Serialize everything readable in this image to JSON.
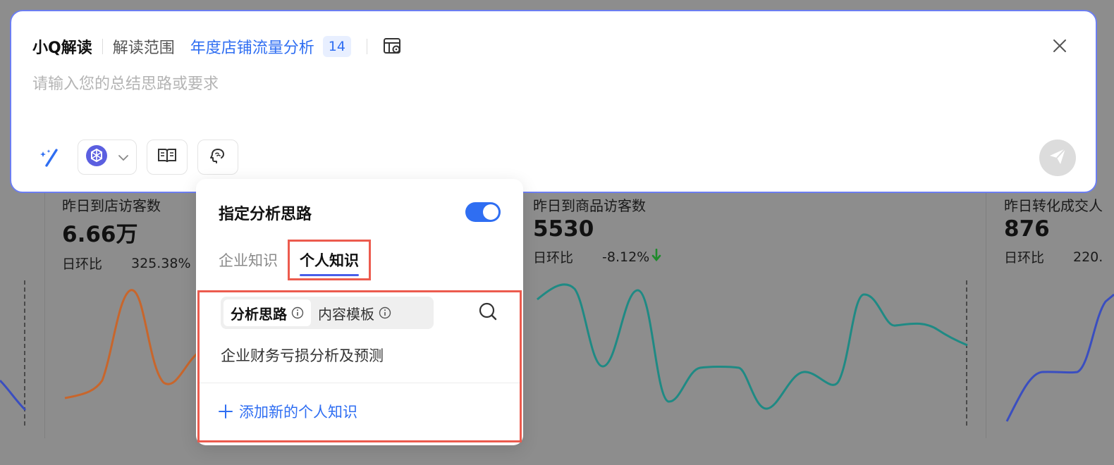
{
  "header": {
    "brand": "小Q解读",
    "scope_label": "解读范围",
    "scope_link": "年度店铺流量分析",
    "scope_count": "14"
  },
  "input": {
    "placeholder": "请输入您的总结思路或要求",
    "value": ""
  },
  "toolbar": {
    "icons": [
      "magic-wand-icon",
      "model-logo-icon",
      "chevron-down-icon",
      "book-icon",
      "brain-chat-icon",
      "send-icon",
      "table-settings-icon",
      "close-icon"
    ]
  },
  "popover": {
    "title": "指定分析思路",
    "toggle_on": true,
    "tabs": [
      {
        "label": "企业知识",
        "active": false
      },
      {
        "label": "个人知识",
        "active": true
      }
    ],
    "segments": [
      {
        "label": "分析思路",
        "active": true
      },
      {
        "label": "内容模板",
        "active": false
      }
    ],
    "entries": [
      {
        "label": "企业财务亏损分析及预测"
      }
    ],
    "add_label": "添加新的个人知识"
  },
  "metrics": [
    {
      "label": "昨日到店访客数",
      "value": "6.66万",
      "change_label": "日环比",
      "change": "325.38%",
      "direction": "up"
    },
    {
      "label": "昨日到商品访客数",
      "value": "5530",
      "change_label": "日环比",
      "change": "-8.12%",
      "direction": "down"
    },
    {
      "label": "昨日转化成交人",
      "value": "876",
      "change_label": "日环比",
      "change": "220.",
      "direction": "up"
    }
  ],
  "colors": {
    "accent": "#2f6ef2",
    "highlight_border": "#ec5b4e",
    "card_border": "#6c7ef2",
    "spark_orange": "#c8662c",
    "spark_teal": "#1f8a84",
    "spark_blue": "#3a4ec0",
    "down_green": "#1f8a2c"
  }
}
